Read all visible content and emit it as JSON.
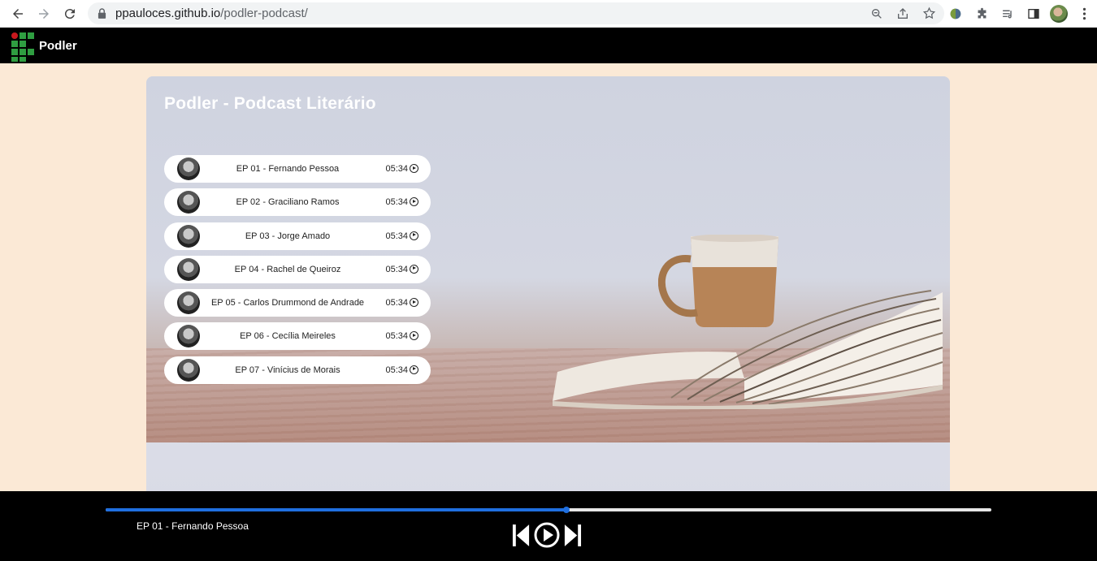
{
  "browser": {
    "url_host": "ppauloces.github.io",
    "url_path": "/podler-podcast/"
  },
  "site": {
    "brand": "Podler",
    "title": "Podler - Podcast Literário"
  },
  "episodes": [
    {
      "label": "EP 01 - Fernando Pessoa",
      "duration": "05:34"
    },
    {
      "label": "EP 02 - Graciliano Ramos",
      "duration": "05:34"
    },
    {
      "label": "EP 03 - Jorge Amado",
      "duration": "05:34"
    },
    {
      "label": "EP 04 - Rachel de Queiroz",
      "duration": "05:34"
    },
    {
      "label": "EP 05 - Carlos Drummond de Andrade",
      "duration": "05:34"
    },
    {
      "label": "EP 06 - Cecília Meireles",
      "duration": "05:34"
    },
    {
      "label": "EP 07 - Vinícius de Morais",
      "duration": "05:34"
    }
  ],
  "player": {
    "now_playing": "EP 01 - Fernando Pessoa",
    "progress": 0.52,
    "accent": "#1f6fe0"
  },
  "colors": {
    "page_bg": "#fbe9d6",
    "header_bg": "#000000",
    "logo_green": "#2f9e41",
    "logo_red": "#c8191e"
  }
}
